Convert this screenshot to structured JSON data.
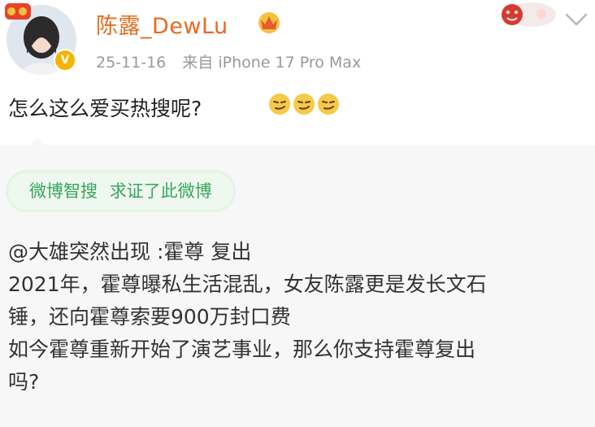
{
  "post": {
    "username": "陈露_DewLu",
    "date": "25-11-16",
    "source": "来自 iPhone 17 Pro Max",
    "text": "怎么这么爱买热搜呢?",
    "emoji_count": 3,
    "emoji_icon": "smirk-emoji-icon"
  },
  "smart_search": {
    "label": "微博智搜",
    "action": "求证了此微博"
  },
  "repost": {
    "line1": "@大雄突然出现 :霍尊 复出",
    "line2": "2021年，霍尊曝私生活混乱，女友陈露更是发长文石",
    "line3": "锤，还向霍尊索要900万封口费",
    "line4": "如今霍尊重新开始了演艺事业，那么你支持霍尊复出",
    "line5": "吗?"
  },
  "colors": {
    "username": "#e86b1f",
    "meta": "#999999",
    "smart_search_text": "#3aa55a",
    "smart_search_bg": "#eef8ef",
    "repost_bg": "#f7f7f7"
  }
}
